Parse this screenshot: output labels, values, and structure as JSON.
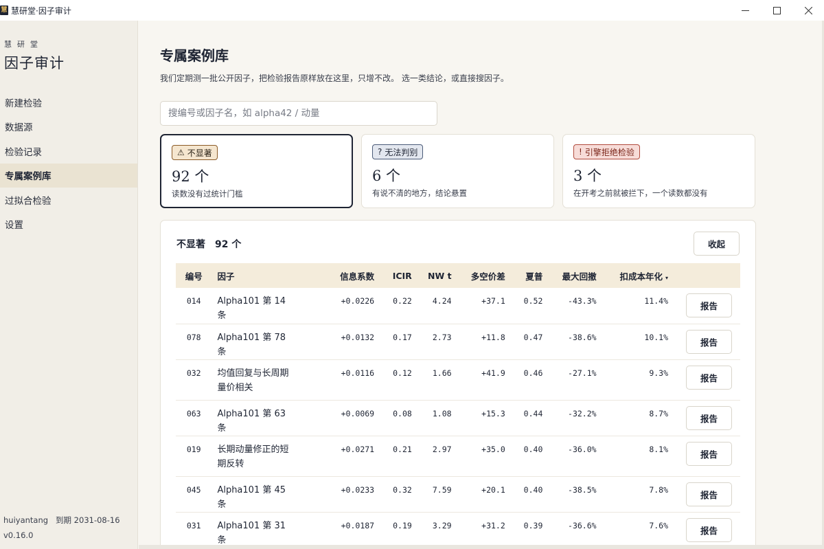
{
  "window": {
    "title": "慧研堂·因子审计",
    "logo_glyph": "慧"
  },
  "sidebar": {
    "brand_sub": "慧研堂",
    "brand_title": "因子审计",
    "items": [
      {
        "label": "新建检验",
        "active": false
      },
      {
        "label": "数据源",
        "active": false
      },
      {
        "label": "检验记录",
        "active": false
      },
      {
        "label": "专属案例库",
        "active": true
      },
      {
        "label": "过拟合检验",
        "active": false
      },
      {
        "label": "设置",
        "active": false
      }
    ],
    "user": "huiyantang",
    "expiry": "到期 2031-08-16",
    "version": "v0.16.0"
  },
  "main": {
    "title": "专属案例库",
    "description": "我们定期测一批公开因子，把检验报告原样放在这里，只增不改。 选一类结论，或直接搜因子。",
    "search_placeholder": "搜编号或因子名，如 alpha42 / 动量",
    "cards": [
      {
        "icon": "⚠",
        "label": "不显著",
        "count": "92 个",
        "note": "读数没有过统计门槛",
        "color": "#8a5a26"
      },
      {
        "icon": "?",
        "label": "无法判别",
        "count": "6 个",
        "note": "有说不清的地方，结论悬置",
        "color": "#4b5b78"
      },
      {
        "icon": "!",
        "label": "引擎拒绝检验",
        "count": "3 个",
        "note": "在开考之前就被拦下，一个读数都没有",
        "color": "#b04a3c"
      }
    ],
    "panel": {
      "label": "不显著",
      "count": "92 个",
      "collapse_label": "收起",
      "columns": [
        "编号",
        "因子",
        "信息系数",
        "ICIR",
        "NW t",
        "多空价差",
        "夏普",
        "最大回撤",
        "扣成本年化"
      ],
      "sort_indicator": "▾",
      "report_label": "报告",
      "rows": [
        {
          "id": "014",
          "name": "Alpha101 第 14 条",
          "ic": "+0.0226",
          "icir": "0.22",
          "nwt": "4.24",
          "spread": "+37.1",
          "sharpe": "0.52",
          "mdd": "-43.3%",
          "ann": "11.4%"
        },
        {
          "id": "078",
          "name": "Alpha101 第 78 条",
          "ic": "+0.0132",
          "icir": "0.17",
          "nwt": "2.73",
          "spread": "+11.8",
          "sharpe": "0.47",
          "mdd": "-38.6%",
          "ann": "10.1%"
        },
        {
          "id": "032",
          "name": "均值回复与长周期量价相关",
          "ic": "+0.0116",
          "icir": "0.12",
          "nwt": "1.66",
          "spread": "+41.9",
          "sharpe": "0.46",
          "mdd": "-27.1%",
          "ann": "9.3%"
        },
        {
          "id": "063",
          "name": "Alpha101 第 63 条",
          "ic": "+0.0069",
          "icir": "0.08",
          "nwt": "1.08",
          "spread": "+15.3",
          "sharpe": "0.44",
          "mdd": "-32.2%",
          "ann": "8.7%"
        },
        {
          "id": "019",
          "name": "长期动量修正的短期反转",
          "ic": "+0.0271",
          "icir": "0.21",
          "nwt": "2.97",
          "spread": "+35.0",
          "sharpe": "0.40",
          "mdd": "-36.0%",
          "ann": "8.1%"
        },
        {
          "id": "045",
          "name": "Alpha101 第 45 条",
          "ic": "+0.0233",
          "icir": "0.32",
          "nwt": "7.59",
          "spread": "+20.1",
          "sharpe": "0.40",
          "mdd": "-38.5%",
          "ann": "7.8%"
        },
        {
          "id": "031",
          "name": "Alpha101 第 31 条",
          "ic": "+0.0187",
          "icir": "0.19",
          "nwt": "3.29",
          "spread": "+31.2",
          "sharpe": "0.39",
          "mdd": "-36.6%",
          "ann": "7.6%"
        }
      ]
    }
  }
}
